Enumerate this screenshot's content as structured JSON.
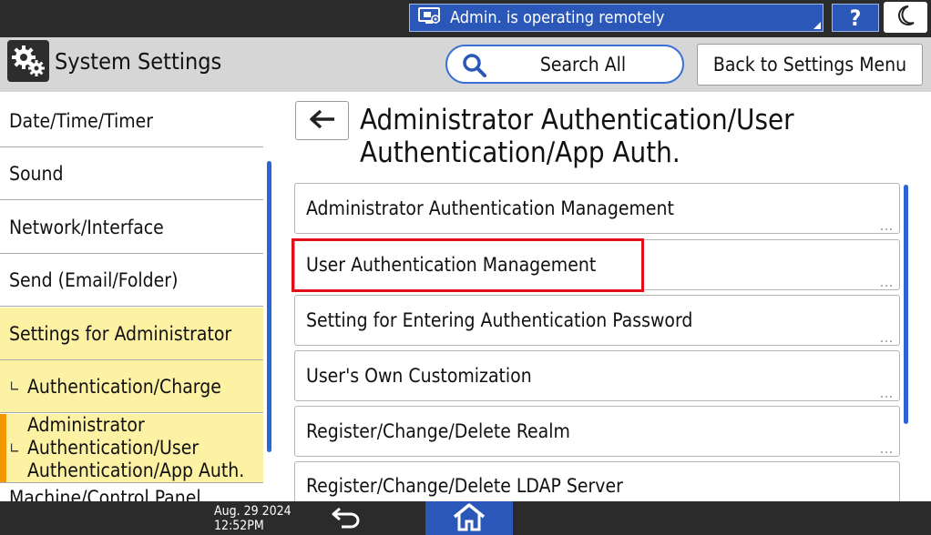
{
  "status_bar": {
    "remote_label": "Admin. is operating remotely",
    "help_label": "?",
    "icons": [
      "remote-monitor-icon",
      "question-icon",
      "moon-icon"
    ]
  },
  "header": {
    "title": "System Settings",
    "search_label": "Search All",
    "back_label": "Back to Settings Menu"
  },
  "left_menu": {
    "items": [
      {
        "label": "Date/Time/Timer"
      },
      {
        "label": "Sound"
      },
      {
        "label": "Network/Interface"
      },
      {
        "label": "Send (Email/Folder)"
      },
      {
        "label": "Settings for Administrator"
      },
      {
        "label": "Authentication/Charge"
      },
      {
        "label_lines": [
          "Administrator",
          "Authentication/User",
          "Authentication/App Auth."
        ]
      },
      {
        "label": "Machine/Control Panel"
      }
    ],
    "sub_marker": "∟"
  },
  "panel": {
    "title": "Administrator Authentication/User Authentication/App Auth.",
    "items": [
      {
        "label": "Administrator Authentication Management"
      },
      {
        "label": "User Authentication Management"
      },
      {
        "label": "Setting for Entering Authentication Password"
      },
      {
        "label": "User's Own Customization"
      },
      {
        "label": "Register/Change/Delete Realm"
      },
      {
        "label": "Register/Change/Delete LDAP Server"
      }
    ],
    "more_marker": "...",
    "highlighted_item": "User Authentication Management"
  },
  "bottom_bar": {
    "date": "Aug. 29 2024",
    "time": "12:52PM"
  },
  "colors": {
    "accent_blue": "#2a57b8",
    "selected_yellow": "#fdf1a3",
    "selected_orange": "#f39600",
    "highlight_red": "#e0101a"
  }
}
